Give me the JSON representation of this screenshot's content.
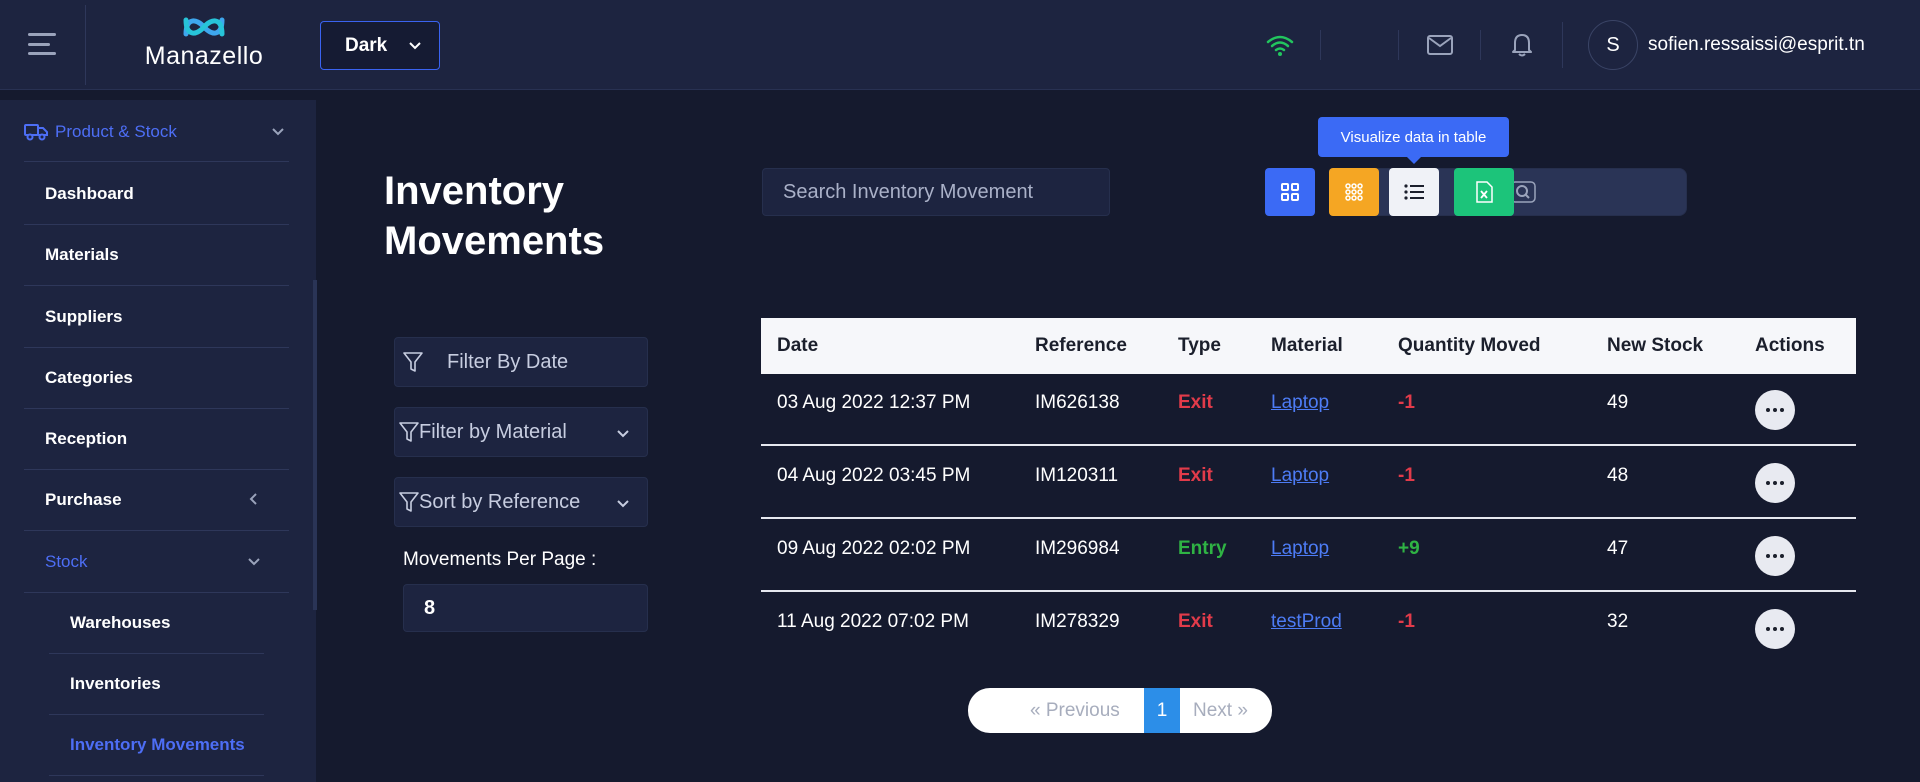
{
  "header": {
    "brand": "Manazello",
    "theme_select": "Dark",
    "avatar_initial": "S",
    "user_email": "sofien.ressaissi@esprit.tn"
  },
  "sidebar": {
    "section": "Product & Stock",
    "items": [
      {
        "label": "Dashboard"
      },
      {
        "label": "Materials"
      },
      {
        "label": "Suppliers"
      },
      {
        "label": "Categories"
      },
      {
        "label": "Reception"
      },
      {
        "label": "Purchase"
      },
      {
        "label": "Stock"
      }
    ],
    "sub_items": [
      {
        "label": "Warehouses"
      },
      {
        "label": "Inventories"
      },
      {
        "label": "Inventory Movements"
      }
    ]
  },
  "main": {
    "title_line1": "Inventory",
    "title_line2": "Movements",
    "search_placeholder": "Search Inventory Movement",
    "tooltip": "Visualize data in table",
    "filters": {
      "date": "Filter By Date",
      "material": "Filter by Material",
      "sort": "Sort by Reference"
    },
    "per_page_label": "Movements Per Page :",
    "per_page_value": "8"
  },
  "table": {
    "headers": [
      "Date",
      "Reference",
      "Type",
      "Material",
      "Quantity Moved",
      "New Stock",
      "Actions"
    ],
    "rows": [
      {
        "date": "03 Aug 2022 12:37 PM",
        "reference": "IM626138",
        "type": "Exit",
        "material": "Laptop",
        "qty": "-1",
        "new_stock": "49"
      },
      {
        "date": "04 Aug 2022 03:45 PM",
        "reference": "IM120311",
        "type": "Exit",
        "material": "Laptop",
        "qty": "-1",
        "new_stock": "48"
      },
      {
        "date": "09 Aug 2022 02:02 PM",
        "reference": "IM296984",
        "type": "Entry",
        "material": "Laptop",
        "qty": "+9",
        "new_stock": "47"
      },
      {
        "date": "11 Aug 2022 07:02 PM",
        "reference": "IM278329",
        "type": "Exit",
        "material": "testProd",
        "qty": "-1",
        "new_stock": "32"
      }
    ]
  },
  "pagination": {
    "prev": "« Previous",
    "current": "1",
    "next": "Next »"
  },
  "colors": {
    "accent": "#3b6af5",
    "exit": "#e23b4a",
    "entry": "#2fb344",
    "grid_button": "#f5a623",
    "excel_button": "#1cc47a"
  }
}
